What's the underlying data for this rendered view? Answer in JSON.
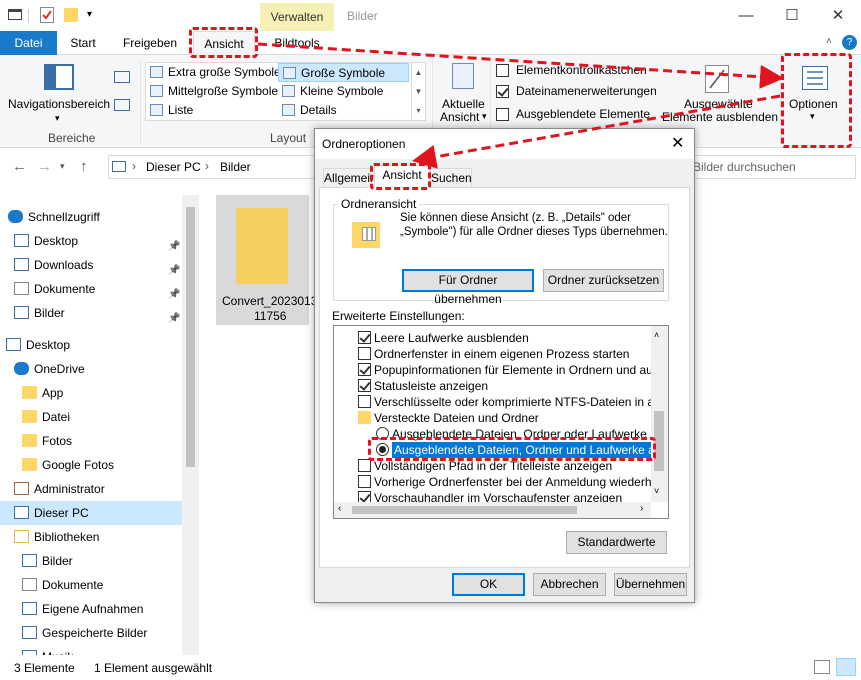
{
  "window": {
    "title": "Bilder",
    "context_tab": "Verwalten"
  },
  "tabs": {
    "file": "Datei",
    "start": "Start",
    "share": "Freigeben",
    "view": "Ansicht",
    "tools": "Bildtools"
  },
  "ribbon": {
    "nav_pane": "Navigationsbereich",
    "group_panes": "Bereiche",
    "group_layout": "Layout",
    "layout_items": [
      "Extra große Symbole",
      "Große Symbole",
      "Mittelgroße Symbole",
      "Kleine Symbole",
      "Liste",
      "Details"
    ],
    "current_view_l1": "Aktuelle",
    "current_view_l2": "Ansicht",
    "checks": [
      "Elementkontrollkästchen",
      "Dateinamenerweiterungen",
      "Ausgeblendete Elemente"
    ],
    "hide_selected_l1": "Ausgewählte",
    "hide_selected_l2": "Elemente ausblenden",
    "options": "Optionen"
  },
  "address": {
    "path": [
      "Dieser PC",
      "Bilder"
    ],
    "search_placeholder": "Bilder durchsuchen"
  },
  "nav": [
    {
      "label": "Schnellzugriff",
      "icon": "star-icon"
    },
    {
      "label": "Desktop",
      "icon": "desktop-icon"
    },
    {
      "label": "Downloads",
      "icon": "download-icon"
    },
    {
      "label": "Dokumente",
      "icon": "document-icon"
    },
    {
      "label": "Bilder",
      "icon": "pictures-icon"
    },
    {
      "label": "Desktop",
      "icon": "desktop-icon"
    },
    {
      "label": "OneDrive",
      "icon": "cloud-icon"
    },
    {
      "label": "App",
      "icon": "folder-icon"
    },
    {
      "label": "Datei",
      "icon": "folder-icon"
    },
    {
      "label": "Fotos",
      "icon": "folder-icon"
    },
    {
      "label": "Google Fotos",
      "icon": "folder-icon"
    },
    {
      "label": "Administrator",
      "icon": "user-icon"
    },
    {
      "label": "Dieser PC",
      "icon": "pc-icon"
    },
    {
      "label": "Bibliotheken",
      "icon": "library-icon"
    },
    {
      "label": "Bilder",
      "icon": "pictures-icon"
    },
    {
      "label": "Dokumente",
      "icon": "document-icon"
    },
    {
      "label": "Eigene Aufnahmen",
      "icon": "pictures-icon"
    },
    {
      "label": "Gespeicherte Bilder",
      "icon": "pictures-icon"
    },
    {
      "label": "Musik",
      "icon": "music-icon"
    }
  ],
  "content": {
    "file_name_l1": "Convert_2023013",
    "file_name_l2": "11756"
  },
  "status": {
    "items": "3 Elemente",
    "selected": "1 Element ausgewählt"
  },
  "dialog": {
    "title": "Ordneroptionen",
    "tabs": [
      "Allgemein",
      "Ansicht",
      "Suchen"
    ],
    "folder_view_legend": "Ordneransicht",
    "folder_view_text_l1": "Sie können diese Ansicht (z. B. „Details\" oder",
    "folder_view_text_l2": "„Symbole\") für alle Ordner dieses Typs übernehmen.",
    "apply_button": "Für Ordner übernehmen",
    "reset_button": "Ordner zurücksetzen",
    "advanced_label": "Erweiterte Einstellungen:",
    "settings": [
      {
        "type": "check",
        "checked": true,
        "label": "Leere Laufwerke ausblenden"
      },
      {
        "type": "check",
        "checked": false,
        "label": "Ordnerfenster in einem eigenen Prozess starten"
      },
      {
        "type": "check",
        "checked": true,
        "label": "Popupinformationen für Elemente in Ordnern und auf dem D"
      },
      {
        "type": "check",
        "checked": true,
        "label": "Statusleiste anzeigen"
      },
      {
        "type": "check",
        "checked": false,
        "label": "Verschlüsselte oder komprimierte NTFS-Dateien in anderer"
      },
      {
        "type": "folder",
        "checked": false,
        "label": "Versteckte Dateien und Ordner"
      },
      {
        "type": "radio",
        "checked": false,
        "label": "Ausgeblendete Dateien, Ordner oder Laufwerke nicht a"
      },
      {
        "type": "radio",
        "checked": true,
        "label": "Ausgeblendete Dateien, Ordner und Laufwerke anzeig"
      },
      {
        "type": "check",
        "checked": false,
        "label": "Vollständigen Pfad in der Titelleiste anzeigen"
      },
      {
        "type": "check",
        "checked": false,
        "label": "Vorherige Ordnerfenster bei der Anmeldung wiederherstellen"
      },
      {
        "type": "check",
        "checked": true,
        "label": "Vorschauhandler im Vorschaufenster anzeigen"
      }
    ],
    "defaults_button": "Standardwerte",
    "ok_button": "OK",
    "cancel_button": "Abbrechen",
    "apply_all_button": "Übernehmen"
  },
  "colors": {
    "accent": "#1979ca",
    "highlight": "#e0141e",
    "selection": "#cce8ff"
  }
}
